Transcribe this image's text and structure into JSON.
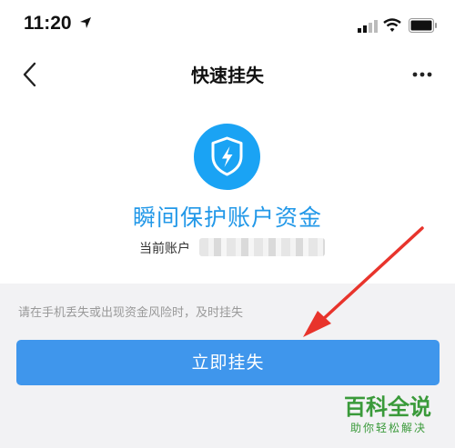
{
  "status_bar": {
    "time": "11:20"
  },
  "nav": {
    "title": "快速挂失"
  },
  "main": {
    "headline": "瞬间保护账户资金",
    "account_label": "当前账户"
  },
  "footer": {
    "hint": "请在手机丢失或出现资金风险时，及时挂失",
    "button_label": "立即挂失"
  },
  "watermark": {
    "title": "百科全说",
    "subtitle": "助你轻松解决"
  },
  "colors": {
    "accent": "#3f96ec",
    "shield": "#1aa3f4",
    "arrow": "#e8342c"
  },
  "icons": [
    "location-arrow-icon",
    "signal-icon",
    "wifi-icon",
    "battery-icon",
    "back-chevron-icon",
    "more-icon",
    "shield-lightning-icon"
  ]
}
